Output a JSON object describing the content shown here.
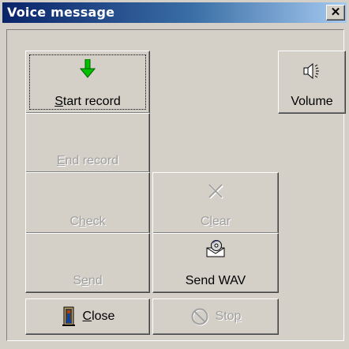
{
  "window": {
    "title": "Voice message",
    "close_glyph": "✕"
  },
  "buttons": {
    "start_record": {
      "pre": "",
      "mnemonic": "S",
      "post": "tart record",
      "icon": "green-down-arrow-icon",
      "enabled": true,
      "focused": true
    },
    "volume": {
      "pre": "",
      "mnemonic": "",
      "post": "Volume",
      "icon": "speaker-icon",
      "enabled": true
    },
    "end_record": {
      "pre": "",
      "mnemonic": "E",
      "post": "nd record",
      "enabled": false
    },
    "check": {
      "pre": "C",
      "mnemonic": "h",
      "post": "eck",
      "enabled": false
    },
    "clear": {
      "pre": "C",
      "mnemonic": "l",
      "post": "ear",
      "icon": "x-cross-icon",
      "enabled": false
    },
    "send": {
      "pre": "S",
      "mnemonic": "e",
      "post": "nd",
      "enabled": false
    },
    "send_wav": {
      "pre": "",
      "mnemonic": "",
      "post": "Send WAV",
      "icon": "envelope-disc-icon",
      "enabled": true
    },
    "close": {
      "pre": "",
      "mnemonic": "C",
      "post": "lose",
      "icon": "door-exit-icon",
      "enabled": true
    },
    "stop": {
      "pre": "Sto",
      "mnemonic": "p",
      "post": "",
      "icon": "no-sign-icon",
      "enabled": false
    }
  },
  "colors": {
    "face": "#d4d0c8",
    "title_start": "#0a246a",
    "title_end": "#a6caf0",
    "disabled_text": "#a0a0a0",
    "arrow_green": "#00c000"
  }
}
